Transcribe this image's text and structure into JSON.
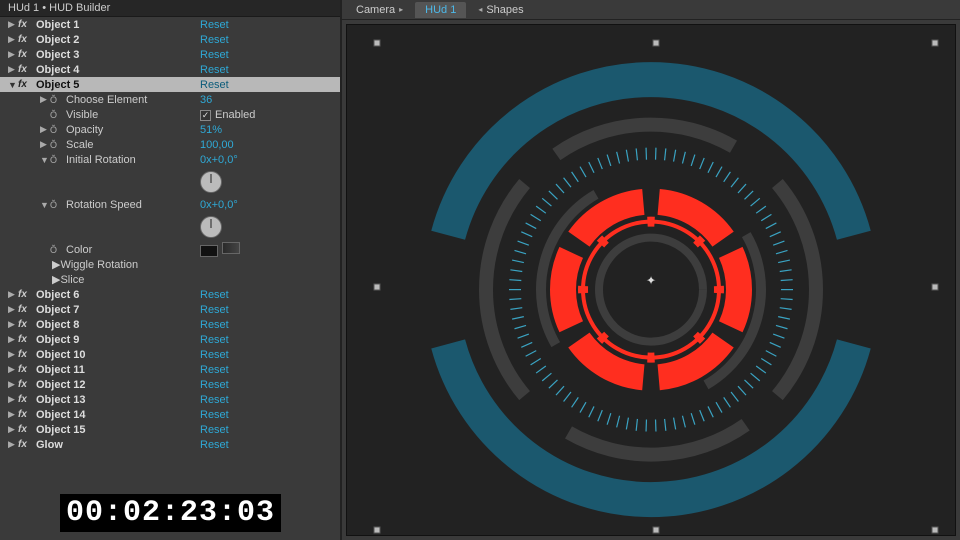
{
  "panel": {
    "title": "HUd 1 • HUD Builder",
    "objects": [
      {
        "name": "Object 1",
        "value": "Reset",
        "expanded": false,
        "selected": false
      },
      {
        "name": "Object 2",
        "value": "Reset",
        "expanded": false,
        "selected": false
      },
      {
        "name": "Object 3",
        "value": "Reset",
        "expanded": false,
        "selected": false
      },
      {
        "name": "Object 4",
        "value": "Reset",
        "expanded": false,
        "selected": false
      },
      {
        "name": "Object 5",
        "value": "Reset",
        "expanded": true,
        "selected": true
      },
      {
        "name": "Object 6",
        "value": "Reset",
        "expanded": false,
        "selected": false
      },
      {
        "name": "Object 7",
        "value": "Reset",
        "expanded": false,
        "selected": false
      },
      {
        "name": "Object 8",
        "value": "Reset",
        "expanded": false,
        "selected": false
      },
      {
        "name": "Object 9",
        "value": "Reset",
        "expanded": false,
        "selected": false
      },
      {
        "name": "Object 10",
        "value": "Reset",
        "expanded": false,
        "selected": false
      },
      {
        "name": "Object 11",
        "value": "Reset",
        "expanded": false,
        "selected": false
      },
      {
        "name": "Object 12",
        "value": "Reset",
        "expanded": false,
        "selected": false
      },
      {
        "name": "Object 13",
        "value": "Reset",
        "expanded": false,
        "selected": false
      },
      {
        "name": "Object 14",
        "value": "Reset",
        "expanded": false,
        "selected": false
      },
      {
        "name": "Object 15",
        "value": "Reset",
        "expanded": false,
        "selected": false
      },
      {
        "name": "Glow",
        "value": "Reset",
        "expanded": false,
        "selected": false
      }
    ],
    "obj5_props": {
      "choose_element_label": "Choose Element",
      "choose_element_value": "36",
      "visible_label": "Visible",
      "visible_value": "Enabled",
      "opacity_label": "Opacity",
      "opacity_value": "51%",
      "scale_label": "Scale",
      "scale_value": "100,00",
      "initial_rotation_label": "Initial Rotation",
      "initial_rotation_value": "0x+0,0°",
      "rotation_speed_label": "Rotation Speed",
      "rotation_speed_value": "0x+0,0°",
      "color_label": "Color",
      "wiggle_label": "Wiggle Rotation",
      "slice_label": "Slice"
    }
  },
  "tabs": {
    "camera": "Camera",
    "hud": "HUd 1",
    "shapes": "Shapes"
  },
  "timecode": "00:02:23:03",
  "colors": {
    "link": "#2fa9d6",
    "hud_red": "#ff2e1f",
    "hud_teal": "#1b586e",
    "hud_cyan": "#3aa3c2",
    "hud_grey": "#3d3d3d"
  }
}
